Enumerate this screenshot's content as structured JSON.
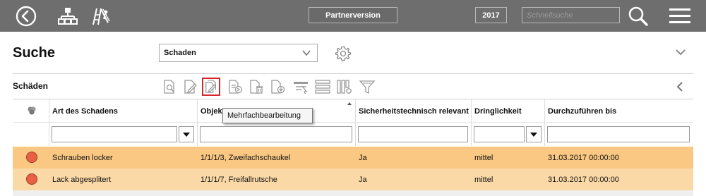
{
  "topbar": {
    "partner_label": "Partnerversion",
    "year": "2017",
    "search_placeholder": "Schnellsuche"
  },
  "search": {
    "title": "Suche",
    "type_selected": "Schaden"
  },
  "section": {
    "title": "Schäden"
  },
  "toolbar": {
    "icons": [
      "view-icon",
      "edit-icon",
      "bulk-edit-icon",
      "export-icon",
      "delete-icon",
      "download-icon",
      "highlight-icon",
      "list-icon",
      "columns-icon",
      "filter-icon"
    ],
    "tooltip": "Mehrfachbearbeitung"
  },
  "table": {
    "columns": [
      "Art des Schadens",
      "Objekt",
      "Sicherheitstechnisch relevant",
      "Dringlichkeit",
      "Durchzuführen bis"
    ],
    "rows": [
      {
        "status_color": "#e86143",
        "art": "Schrauben locker",
        "objekt": "1/1/1/3, Zweifachschaukel",
        "relevant": "Ja",
        "dringlichkeit": "mittel",
        "bis": "31.03.2017 00:00:00"
      },
      {
        "status_color": "#e86143",
        "art": "Lack abgesplitert",
        "objekt": "1/1/1/7, Freifallrutsche",
        "relevant": "Ja",
        "dringlichkeit": "mittel",
        "bis": "31.03.2017 00:00:00"
      }
    ]
  },
  "colors": {
    "topbar": "#6e6e6e",
    "row_primary": "#fac882",
    "row_secondary": "#fbd9a7",
    "status_red": "#e86143",
    "highlight_border": "#d9262b"
  }
}
